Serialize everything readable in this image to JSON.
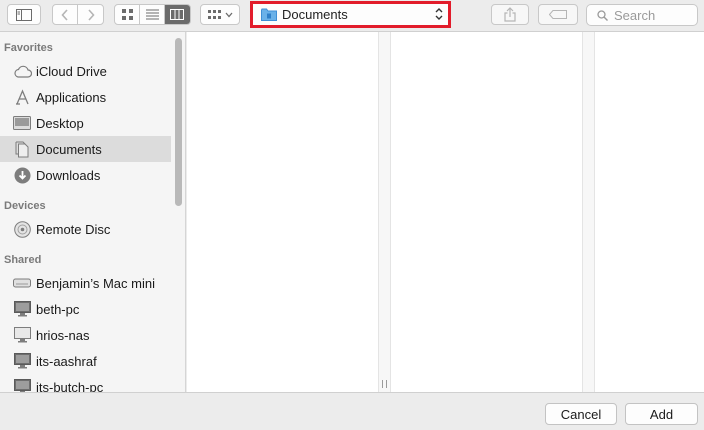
{
  "toolbar": {
    "location_popup": {
      "label": "Documents",
      "folder_icon": "folder-icon"
    },
    "search": {
      "placeholder": "Search"
    }
  },
  "sidebar": {
    "favorites": {
      "title": "Favorites",
      "items": [
        {
          "label": "iCloud Drive",
          "icon": "cloud-icon"
        },
        {
          "label": "Applications",
          "icon": "applications-icon"
        },
        {
          "label": "Desktop",
          "icon": "desktop-icon"
        },
        {
          "label": "Documents",
          "icon": "documents-icon",
          "selected": true
        },
        {
          "label": "Downloads",
          "icon": "downloads-icon"
        }
      ]
    },
    "devices": {
      "title": "Devices",
      "items": [
        {
          "label": "Remote Disc",
          "icon": "disc-icon"
        }
      ]
    },
    "shared": {
      "title": "Shared",
      "items": [
        {
          "label": "Benjamin’s Mac mini",
          "icon": "mac-mini-icon"
        },
        {
          "label": "beth-pc",
          "icon": "display-icon"
        },
        {
          "label": "hrios-nas",
          "icon": "display-icon"
        },
        {
          "label": "its-aashraf",
          "icon": "display-icon"
        },
        {
          "label": "its-butch-pc",
          "icon": "display-icon"
        }
      ]
    }
  },
  "footer": {
    "cancel_label": "Cancel",
    "add_label": "Add"
  }
}
